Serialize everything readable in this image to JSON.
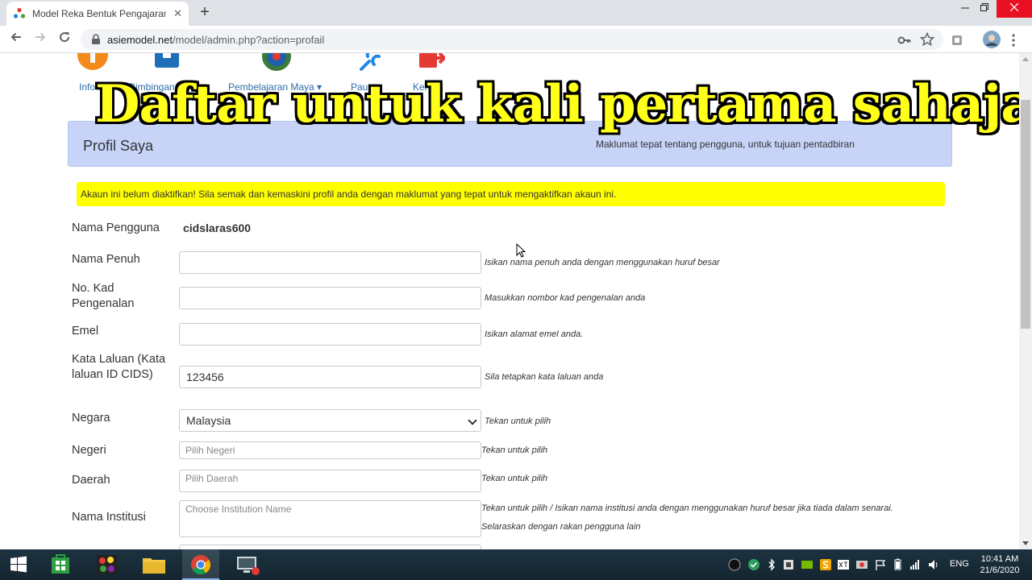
{
  "browser": {
    "tab_title": "Model Reka Bentuk Pengajaran B",
    "url_host": "asiemodel.net",
    "url_path": "/model/admin.php?action=profail",
    "new_tab_glyph": "+",
    "tab_close_glyph": "✕",
    "icons": [
      "back-icon",
      "forward-icon",
      "reload-icon",
      "lock-icon",
      "key-icon",
      "star-icon",
      "extension-icon",
      "avatar",
      "menu-icon"
    ]
  },
  "nav": {
    "items": [
      {
        "label": "Info",
        "icon": "info-icon"
      },
      {
        "label": "Bimbingan",
        "icon": "guide-icon"
      },
      {
        "label": "Pembelajaran Maya ▾",
        "icon": "globe-icon"
      },
      {
        "label": "Pautan",
        "icon": "link-icon"
      },
      {
        "label": "Kel ▾",
        "icon": "logout-icon"
      }
    ]
  },
  "overlay": {
    "caption": "Daftar  untuk kali pertama sahaja",
    "color": "#ffff1a"
  },
  "profile": {
    "title": "Profil Saya",
    "subtitle": "Maklumat tepat tentang pengguna, untuk tujuan pentadbiran"
  },
  "alert": {
    "text": "Akaun ini belum diaktifkan! Sila semak dan kemaskini profil anda dengan maklumat yang tepat untuk mengaktifkan akaun ini.",
    "color": "#ffff00"
  },
  "form": {
    "username": {
      "label": "Nama Pengguna",
      "value": "cidslaras600"
    },
    "fullname": {
      "label": "Nama Penuh",
      "value": "",
      "hint": "Isikan nama penuh anda dengan menggunakan huruf besar"
    },
    "ic": {
      "label": "No. Kad Pengenalan",
      "value": "",
      "hint": "Masukkan nombor kad pengenalan anda"
    },
    "email": {
      "label": "Emel",
      "value": "",
      "hint": "Isikan alamat emel anda."
    },
    "password": {
      "label": "Kata Laluan (Kata laluan ID CIDS)",
      "value": "123456",
      "hint": "Sila tetapkan kata laluan anda"
    },
    "country": {
      "label": "Negara",
      "value": "Malaysia",
      "hint": "Tekan untuk pilih"
    },
    "state": {
      "label": "Negeri",
      "placeholder": "Pilih Negeri",
      "hint": "Tekan untuk pilih"
    },
    "district": {
      "label": "Daerah",
      "placeholder": "Pilih Daerah",
      "hint": "Tekan untuk pilih"
    },
    "institution": {
      "label": "Nama Institusi",
      "placeholder": "Choose Institution Name",
      "hint": "Tekan untuk pilih / Isikan nama institusi anda dengan menggunakan huruf besar jika tiada dalam senarai.",
      "hint2": "Selaraskan dengan rakan pengguna lain"
    }
  },
  "taskbar": {
    "apps": [
      "start-icon",
      "store-icon",
      "paint-icon",
      "explorer-icon",
      "chrome-icon",
      "recorder-icon"
    ],
    "language": "ENG",
    "time": "10:41 AM",
    "date": "21/6/2020"
  }
}
